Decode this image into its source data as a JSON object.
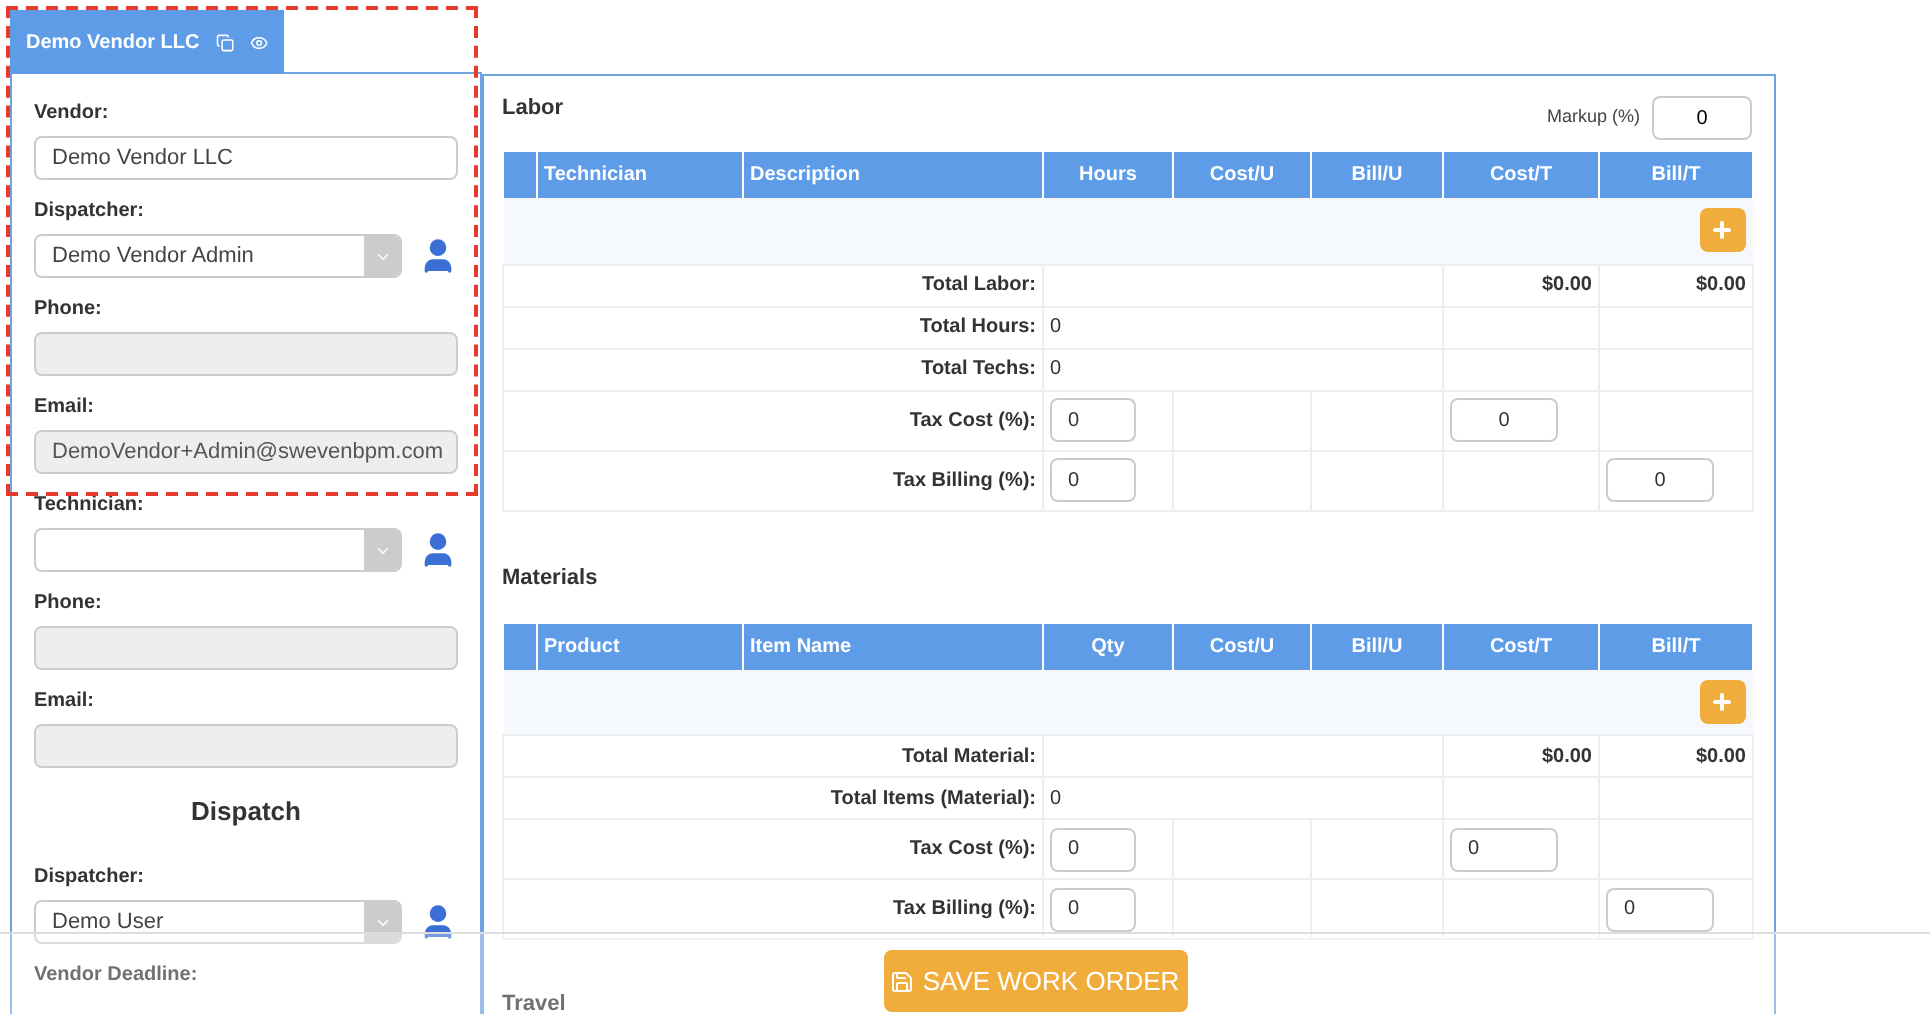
{
  "vendor_tab": {
    "title": "Demo Vendor LLC"
  },
  "vendor_fields": [
    {
      "label": "Vendor:",
      "kind": "text",
      "value": "Demo Vendor LLC"
    },
    {
      "label": "Dispatcher:",
      "kind": "select",
      "value": "Demo  Vendor Admin"
    },
    {
      "label": "Phone:",
      "kind": "readonly"
    },
    {
      "label": "Email:",
      "kind": "readonly",
      "value": "DemoVendor+Admin@swevenbpm.com"
    },
    {
      "label": "Technician:",
      "kind": "select"
    },
    {
      "label": "Phone:",
      "kind": "readonly"
    },
    {
      "label": "Email:",
      "kind": "readonly"
    }
  ],
  "dispatch": {
    "title": "Dispatch",
    "fields": [
      {
        "label": "Dispatcher:",
        "kind": "select",
        "value": "Demo User"
      },
      {
        "label": "Vendor Deadline:",
        "kind": "label"
      }
    ]
  },
  "sections": [
    {
      "title": "Labor",
      "markup": {
        "label": "Markup (%)",
        "value": "0"
      },
      "columns": [
        "Technician",
        "Description",
        "Hours",
        "Cost/U",
        "Bill/U",
        "Cost/T",
        "Bill/T"
      ],
      "summary": [
        {
          "kind": "amounts",
          "label": "Total Labor:",
          "cost_total": "$0.00",
          "bill_total": "$0.00"
        },
        {
          "kind": "count",
          "label": "Total Hours:",
          "value": "0"
        },
        {
          "kind": "count",
          "label": "Total Techs:",
          "value": "0"
        },
        {
          "kind": "tax",
          "label": "Tax Cost (%):",
          "first_input": "0",
          "cost_total_input": "0"
        },
        {
          "kind": "tax",
          "label": "Tax Billing (%):",
          "first_input": "0",
          "bill_total_input": "0"
        }
      ]
    },
    {
      "title": "Materials",
      "columns": [
        "Product",
        "Item Name",
        "Qty",
        "Cost/U",
        "Bill/U",
        "Cost/T",
        "Bill/T"
      ],
      "summary": [
        {
          "kind": "amounts",
          "label": "Total Material:",
          "cost_total": "$0.00",
          "bill_total": "$0.00"
        },
        {
          "kind": "count",
          "label": "Total Items (Material):",
          "value": "0"
        },
        {
          "kind": "tax",
          "label": "Tax Cost (%):",
          "first_input": "0",
          "cost_total_input": "0"
        },
        {
          "kind": "tax",
          "label": "Tax Billing (%):",
          "first_input": "0",
          "bill_total_input": "0"
        }
      ]
    }
  ],
  "next_section": {
    "title": "Travel"
  },
  "save_button": {
    "label": "SAVE WORK ORDER"
  }
}
